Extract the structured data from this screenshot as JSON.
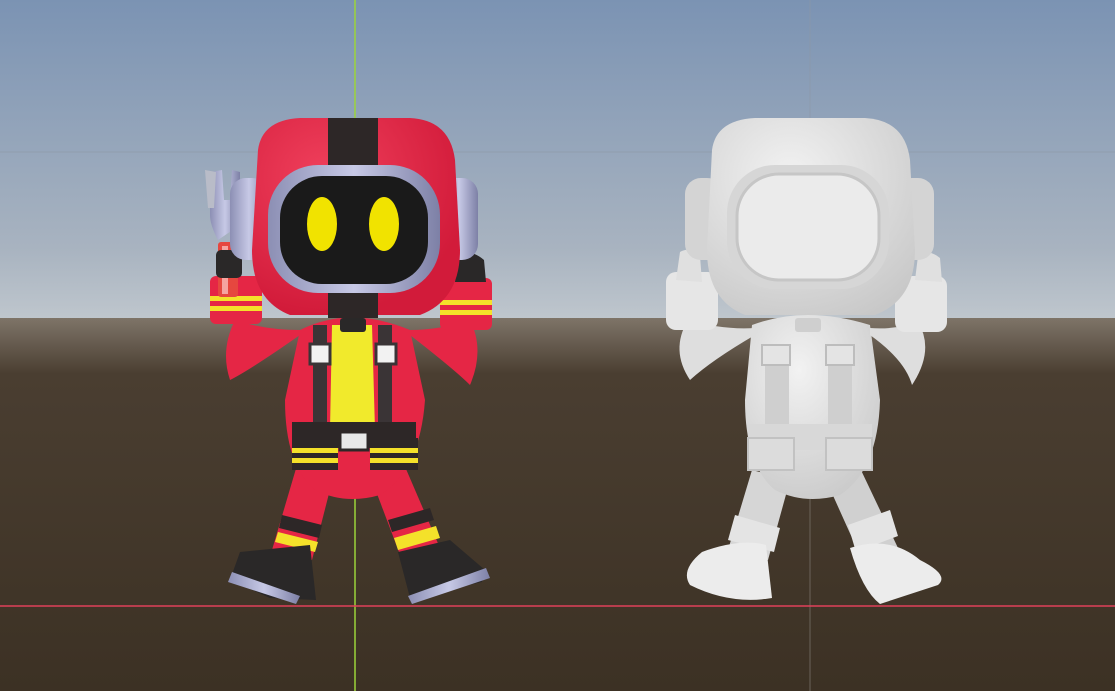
{
  "scene": {
    "view": "3d-viewport",
    "sky_top_color": "#7b93b3",
    "sky_horizon_color": "#c2c9cf",
    "ground_color": "#3c3124",
    "grid_line_color": "#8d98a6",
    "y_axis_color": "#9bd43a",
    "x_axis_color": "#e0405a"
  },
  "characters": [
    {
      "name": "textured-robot-astronaut",
      "suit_color": "#e52645",
      "visor_color": "#1a1a1a",
      "eye_color": "#f1e300",
      "accent_color": "#f4e12a",
      "helmet_stripe_color": "#2d2727",
      "headphone_color": "#a3a6c9",
      "held_item": "wrench-icon"
    },
    {
      "name": "untextured-robot-astronaut",
      "material": "default-gray",
      "suit_color": "#dedede"
    }
  ]
}
